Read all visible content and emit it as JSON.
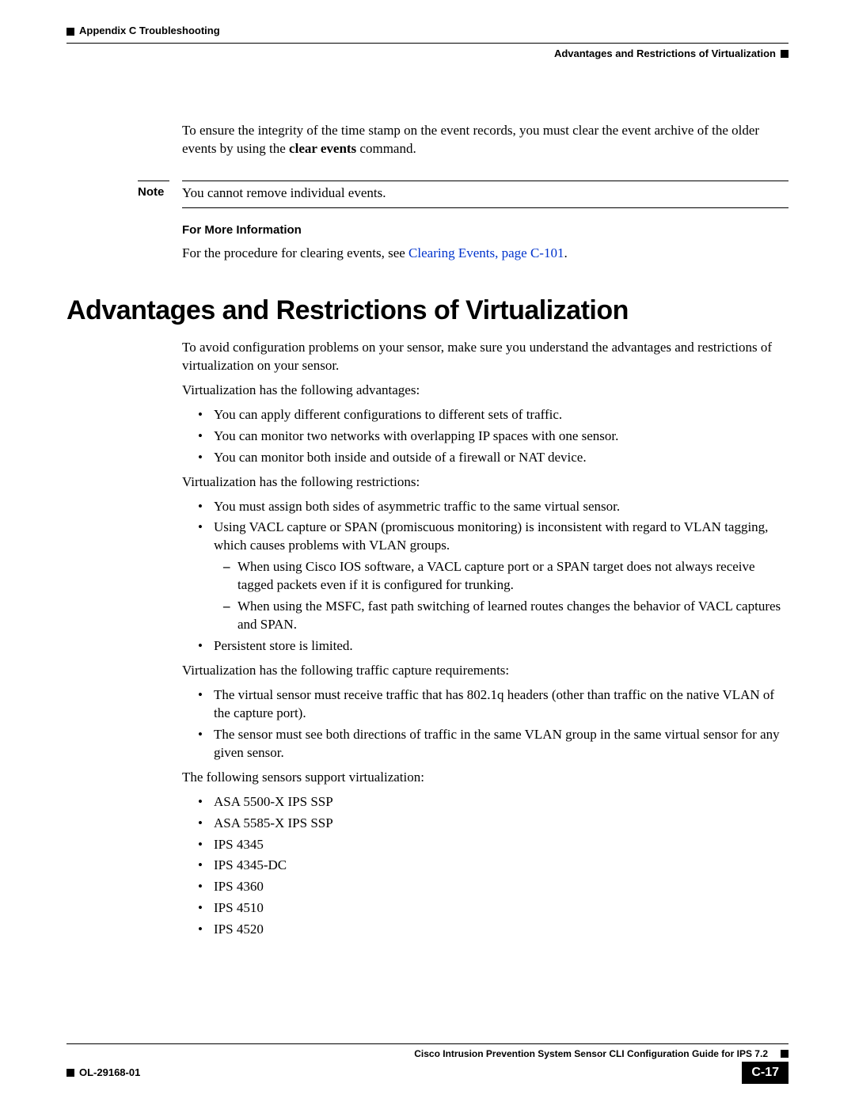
{
  "header": {
    "left": "Appendix C    Troubleshooting",
    "right": "Advantages and Restrictions of Virtualization"
  },
  "intro": {
    "p1_a": "To ensure the integrity of the time stamp on the event records, you must clear the event archive of the older events by using the ",
    "p1_cmd": "clear events",
    "p1_b": " command."
  },
  "note": {
    "label": "Note",
    "text": "You cannot remove individual events."
  },
  "fmi": {
    "heading": "For More Information",
    "text_a": "For the procedure for clearing events, see ",
    "link": "Clearing Events, page C-101",
    "text_b": "."
  },
  "section_title": "Advantages and Restrictions of Virtualization",
  "body": {
    "p1": "To avoid configuration problems on your sensor, make sure you understand the advantages and restrictions of virtualization on your sensor.",
    "adv_intro": "Virtualization has the following advantages:",
    "adv": [
      "You can apply different configurations to different sets of traffic.",
      "You can monitor two networks with overlapping IP spaces with one sensor.",
      "You can monitor both inside and outside of a firewall or NAT device."
    ],
    "res_intro": "Virtualization has the following restrictions:",
    "res": [
      "You must assign both sides of asymmetric traffic to the same virtual sensor.",
      "Using VACL capture or SPAN (promiscuous monitoring) is inconsistent with regard to VLAN tagging, which causes problems with VLAN groups.",
      "Persistent store is limited."
    ],
    "res_sub": [
      "When using Cisco IOS software, a VACL capture port or a SPAN target does not always receive tagged packets even if it is configured for trunking.",
      "When using the MSFC, fast path switching of learned routes changes the behavior of VACL captures and SPAN."
    ],
    "req_intro": "Virtualization has the following traffic capture requirements:",
    "req": [
      "The virtual sensor must receive traffic that has 802.1q headers (other than traffic on the native VLAN of the capture port).",
      "The sensor must see both directions of traffic in the same VLAN group in the same virtual sensor for any given sensor."
    ],
    "support_intro": "The following sensors support virtualization:",
    "support": [
      "ASA 5500-X IPS SSP",
      "ASA 5585-X IPS SSP",
      "IPS 4345",
      "IPS 4345-DC",
      "IPS 4360",
      "IPS 4510",
      "IPS 4520"
    ]
  },
  "footer": {
    "book": "Cisco Intrusion Prevention System Sensor CLI Configuration Guide for IPS 7.2",
    "doc": "OL-29168-01",
    "page": "C-17"
  }
}
